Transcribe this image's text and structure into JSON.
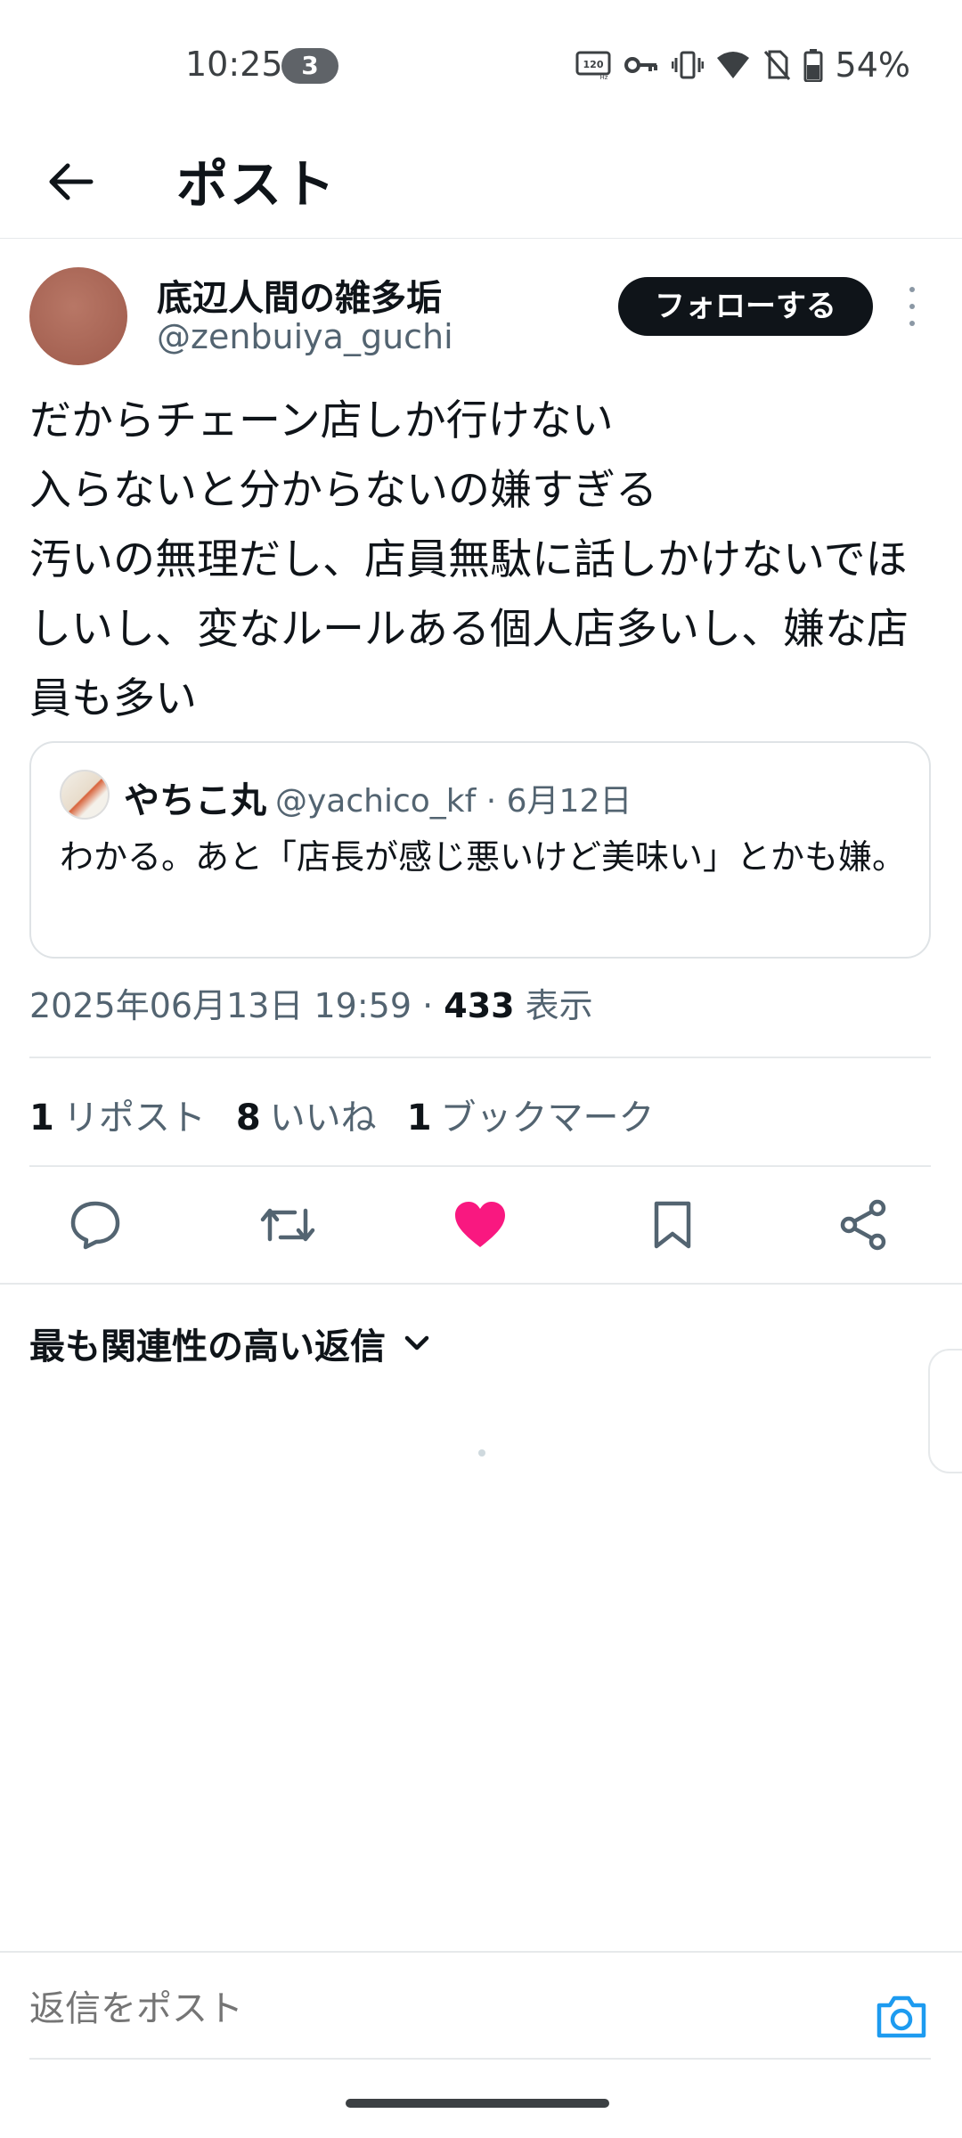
{
  "status_bar": {
    "time": "10:25",
    "notification_count": "3",
    "battery": "54%",
    "icons": [
      "refresh-rate-120hz-icon",
      "vpn-key-icon",
      "vibrate-icon",
      "wifi-icon",
      "no-sim-icon",
      "battery-icon"
    ]
  },
  "header": {
    "title": "ポスト",
    "back_icon": "arrow-left-icon"
  },
  "post": {
    "author": {
      "display_name": "底辺人間の雑多垢",
      "handle": "@zenbuiya_guchi"
    },
    "follow_label": "フォローする",
    "body": "だからチェーン店しか行けない\n入らないと分からないの嫌すぎる\n汚いの無理だし、店員無駄に話しかけないでほしいし、変なルールある個人店多いし、嫌な店員も多い",
    "quote": {
      "display_name": "やちこ丸",
      "handle": "@yachico_kf",
      "date": "6月12日",
      "meta": "@yachico_kf · 6月12日",
      "text": "わかる。あと「店長が感じ悪いけど美味い」とかも嫌。"
    },
    "timestamp": "2025年06月13日 19:59 · ",
    "views_count": "433",
    "views_label": " 表示",
    "stats": {
      "reposts_count": "1",
      "reposts_label": "リポスト",
      "likes_count": "8",
      "likes_label": "いいね",
      "bookmarks_count": "1",
      "bookmarks_label": "ブックマーク"
    },
    "liked": true,
    "like_color": "#f91880"
  },
  "replies": {
    "sort_label": "最も関連性の高い返信"
  },
  "reply_bar": {
    "placeholder": "返信をポスト",
    "accent": "#1d9bf0"
  }
}
